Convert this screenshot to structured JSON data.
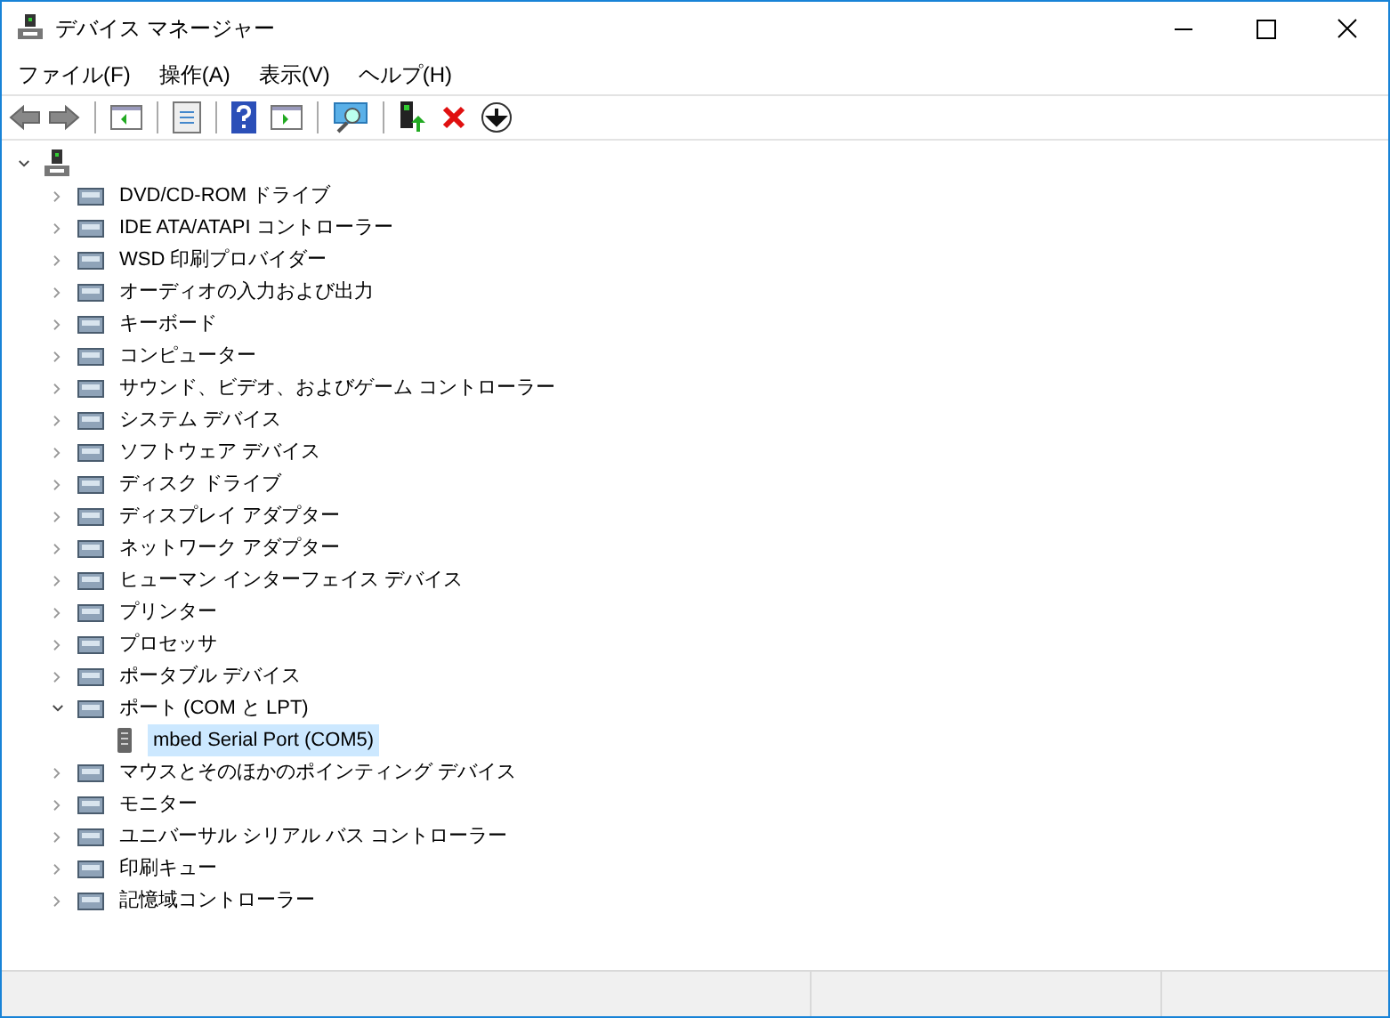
{
  "window": {
    "title": "デバイス マネージャー"
  },
  "menu": [
    "ファイル(F)",
    "操作(A)",
    "表示(V)",
    "ヘルプ(H)"
  ],
  "tree": {
    "expanded": true,
    "children": [
      {
        "label": "DVD/CD-ROM ドライブ",
        "expanded": false,
        "selected": false
      },
      {
        "label": "IDE ATA/ATAPI コントローラー",
        "expanded": false,
        "selected": false
      },
      {
        "label": "WSD 印刷プロバイダー",
        "expanded": false,
        "selected": false
      },
      {
        "label": "オーディオの入力および出力",
        "expanded": false,
        "selected": false
      },
      {
        "label": "キーボード",
        "expanded": false,
        "selected": false
      },
      {
        "label": "コンピューター",
        "expanded": false,
        "selected": false
      },
      {
        "label": "サウンド、ビデオ、およびゲーム コントローラー",
        "expanded": false,
        "selected": false
      },
      {
        "label": "システム デバイス",
        "expanded": false,
        "selected": false
      },
      {
        "label": "ソフトウェア デバイス",
        "expanded": false,
        "selected": false
      },
      {
        "label": "ディスク ドライブ",
        "expanded": false,
        "selected": false
      },
      {
        "label": "ディスプレイ アダプター",
        "expanded": false,
        "selected": false
      },
      {
        "label": "ネットワーク アダプター",
        "expanded": false,
        "selected": false
      },
      {
        "label": "ヒューマン インターフェイス デバイス",
        "expanded": false,
        "selected": false
      },
      {
        "label": "プリンター",
        "expanded": false,
        "selected": false
      },
      {
        "label": "プロセッサ",
        "expanded": false,
        "selected": false
      },
      {
        "label": "ポータブル デバイス",
        "expanded": false,
        "selected": false
      },
      {
        "label": "ポート (COM と LPT)",
        "expanded": true,
        "selected": false,
        "children": [
          {
            "label": "mbed Serial Port (COM5)",
            "selected": true
          }
        ]
      },
      {
        "label": "マウスとそのほかのポインティング デバイス",
        "expanded": false,
        "selected": false
      },
      {
        "label": "モニター",
        "expanded": false,
        "selected": false
      },
      {
        "label": "ユニバーサル シリアル バス コントローラー",
        "expanded": false,
        "selected": false
      },
      {
        "label": "印刷キュー",
        "expanded": false,
        "selected": false
      },
      {
        "label": "記憶域コントローラー",
        "expanded": false,
        "selected": false
      }
    ]
  }
}
